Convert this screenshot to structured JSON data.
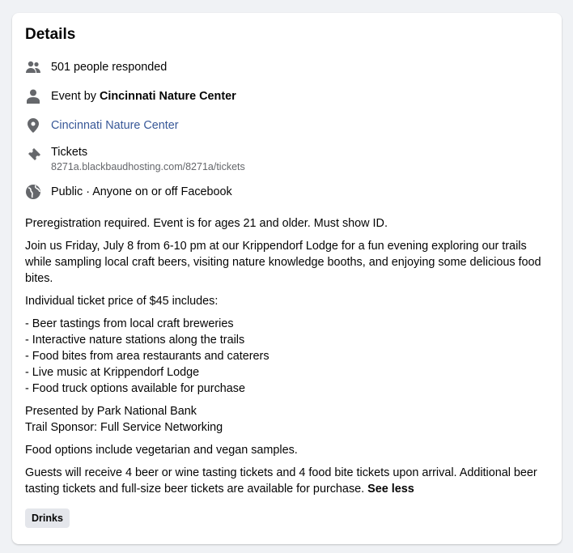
{
  "title": "Details",
  "rows": {
    "responded": "501 people responded",
    "event_by_prefix": "Event by ",
    "event_by_name": "Cincinnati Nature Center",
    "location": "Cincinnati Nature Center",
    "tickets_label": "Tickets",
    "tickets_url": "8271a.blackbaudhosting.com/8271a/tickets",
    "privacy": "Public · Anyone on or off Facebook"
  },
  "description": {
    "p1": "Preregistration required. Event is for ages 21 and older. Must show ID.",
    "p2": "Join us Friday, July 8 from 6-10 pm at our Krippendorf Lodge for a fun evening exploring our trails while sampling local craft beers, visiting nature knowledge booths, and enjoying some delicious food bites.",
    "p3": "Individual ticket price of $45 includes:",
    "list": [
      "- Beer tastings from local craft breweries",
      "- Interactive nature stations along the trails",
      "- Food bites from area restaurants and caterers",
      "- Live music at Krippendorf Lodge",
      "- Food truck options available for purchase"
    ],
    "sponsor1": "Presented by Park National Bank",
    "sponsor2": "Trail Sponsor: Full Service Networking",
    "p5": "Food options include vegetarian and vegan samples.",
    "p6": "Guests will receive 4 beer or wine tasting tickets and 4 food bite tickets upon arrival. Additional beer tasting tickets and full-size beer tickets are available for purchase. ",
    "see_less": "See less"
  },
  "tag": "Drinks",
  "colors": {
    "link": "#385898",
    "icon": "#65676b",
    "background": "#f0f2f5"
  }
}
